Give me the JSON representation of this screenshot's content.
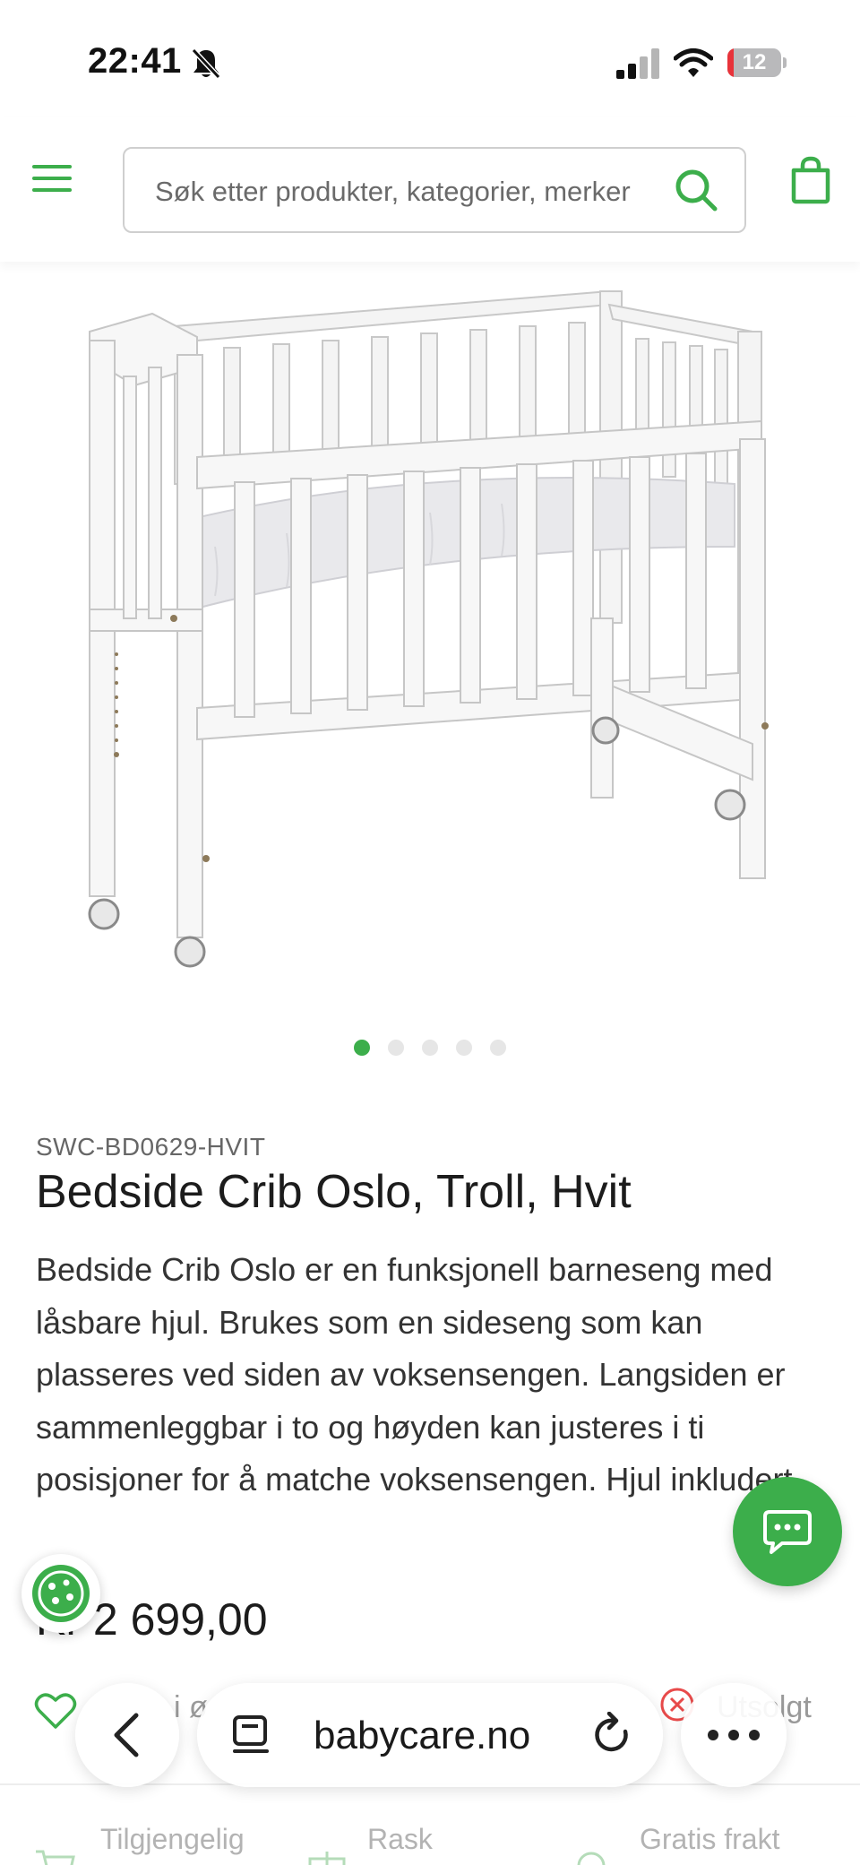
{
  "status_bar": {
    "time": "22:41",
    "battery": "12",
    "battery_level": 0.12,
    "icons": [
      "bell-slash-icon",
      "signal-icon",
      "wifi-icon",
      "battery-icon"
    ]
  },
  "header": {
    "search_placeholder": "Søk etter produkter, kategorier, merker",
    "icons": [
      "menu-icon",
      "search-icon",
      "shopping-bag-icon"
    ]
  },
  "colors": {
    "brand_green": "#3cae4b",
    "text": "#1c1c1c",
    "muted": "#666666"
  },
  "carousel": {
    "count": 5,
    "active_index": 0
  },
  "product": {
    "sku": "SWC-BD0629-HVIT",
    "title": "Bedside Crib Oslo, Troll, Hvit",
    "description": "Bedside Crib Oslo er en funksjonell barneseng med låsbare hjul. Brukes som en sideseng som kan plasseres ved siden av voksensengen. Langsiden er sammenleggbar i to og høyden kan justeres i ti posisjoner for å matche voksensengen. Hjul inkludert.",
    "price": "Kr 2 699,00"
  },
  "actions": {
    "wishlist_label": "i ø",
    "soldout_label": "Utsolgt"
  },
  "usps": [
    {
      "label": "Tilgjengelig",
      "icon": "cart-icon"
    },
    {
      "label": "Rask",
      "icon": "gift-icon"
    },
    {
      "label": "Gratis frakt",
      "icon": "truck-icon"
    }
  ],
  "browser": {
    "url": "babycare.no",
    "icons": [
      "back-icon",
      "tabs-icon",
      "reload-icon",
      "more-icon"
    ]
  }
}
